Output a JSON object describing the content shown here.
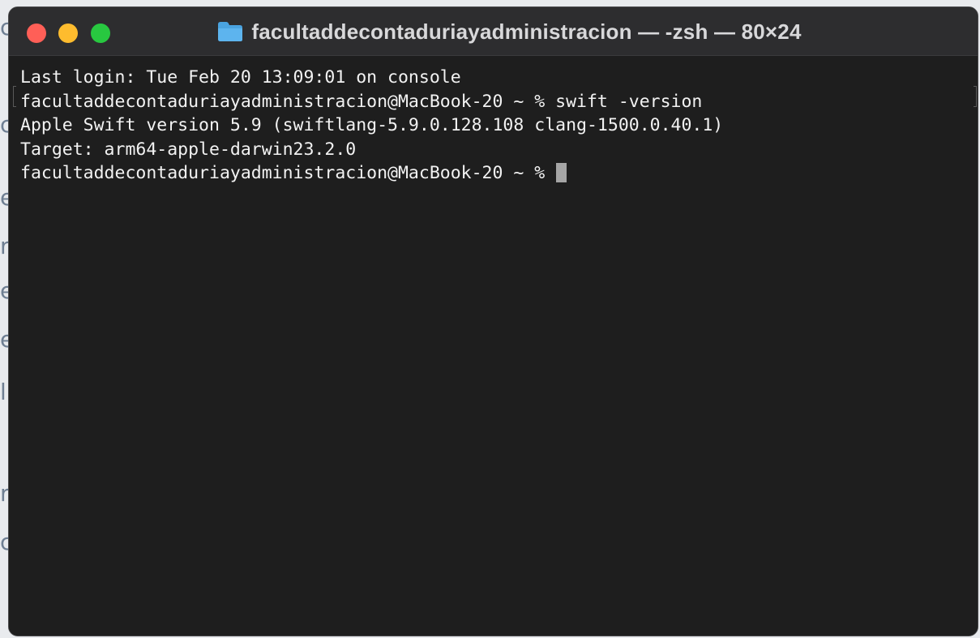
{
  "window": {
    "title": "facultaddecontaduriayadministracion — -zsh — 80×24",
    "folder_icon": "folder-icon",
    "traffic_lights": {
      "close": "#ff5f57",
      "minimize": "#febc2e",
      "maximize": "#28c840"
    }
  },
  "terminal": {
    "lines": [
      "Last login: Tue Feb 20 13:09:01 on console",
      "facultaddecontaduriayadministracion@MacBook-20 ~ % swift -version",
      "Apple Swift version 5.9 (swiftlang-5.9.0.128.108 clang-1500.0.40.1)",
      "Target: arm64-apple-darwin23.2.0"
    ],
    "prompt": "facultaddecontaduriayadministracion@MacBook-20 ~ % ",
    "background": "#1e1e1e",
    "foreground": "#f2f2f2",
    "cursor_color": "#a5a5a5"
  }
}
